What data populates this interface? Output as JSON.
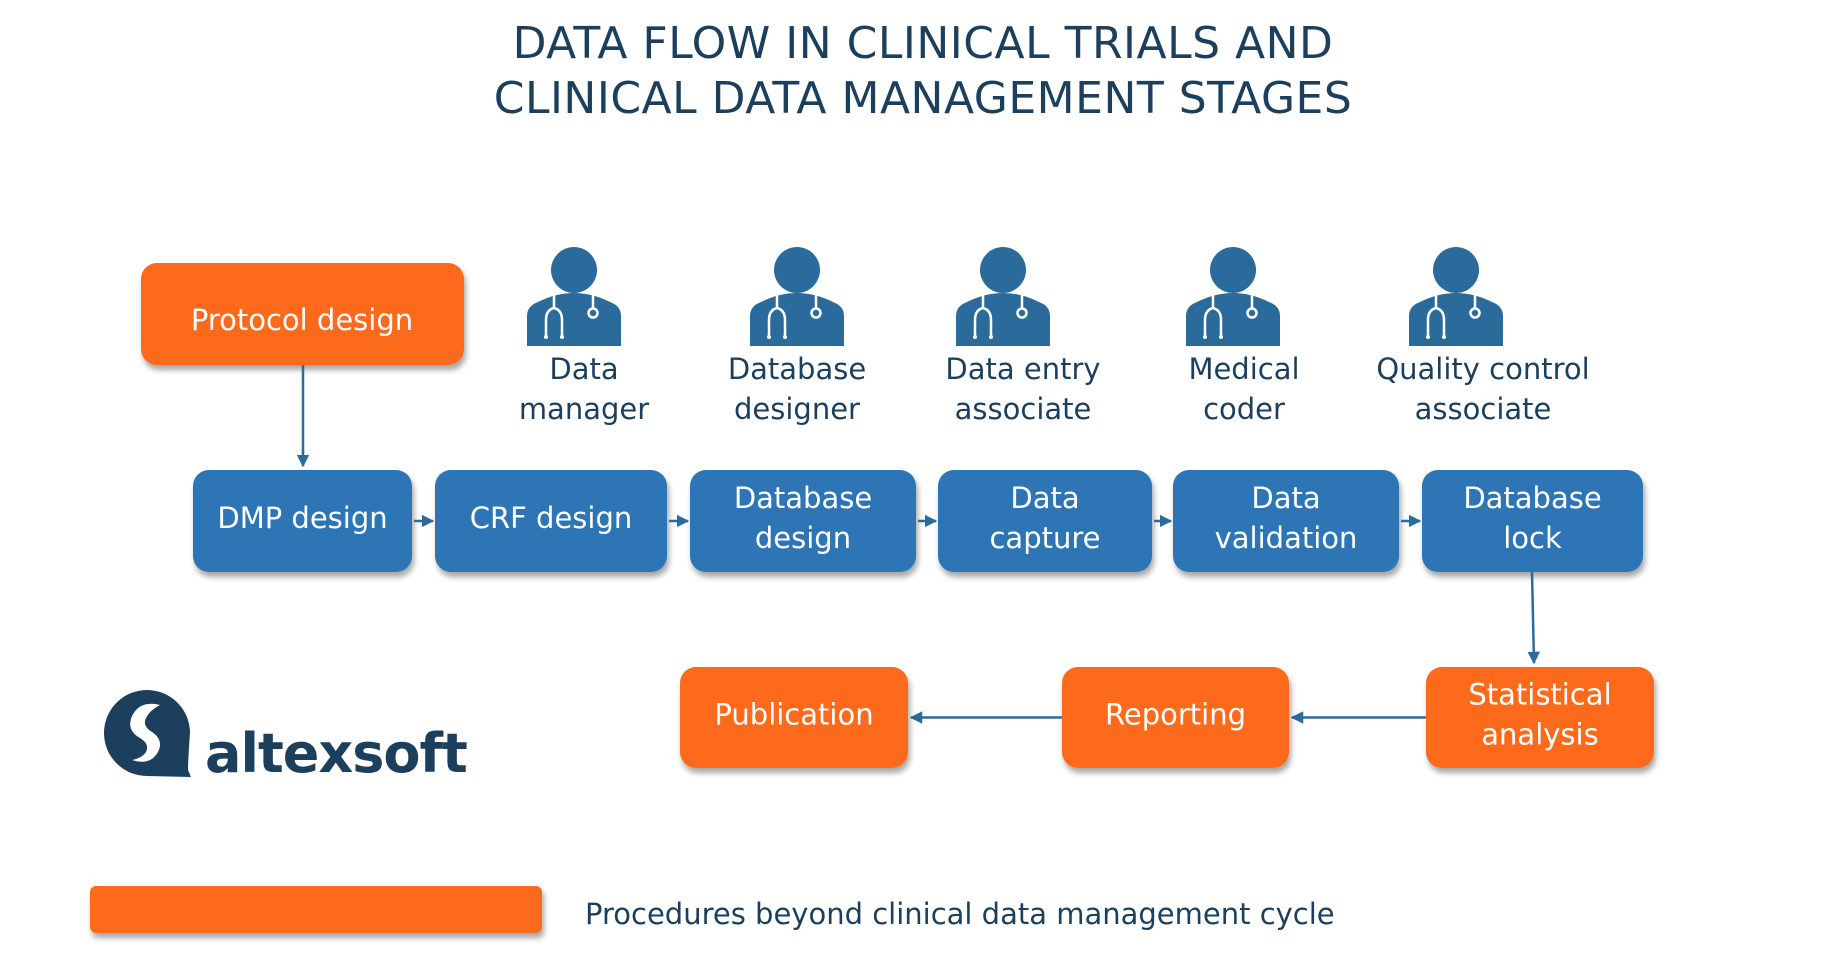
{
  "title": {
    "line1": "DATA FLOW IN CLINICAL TRIALS AND",
    "line2": "CLINICAL DATA MANAGEMENT STAGES"
  },
  "colors": {
    "orange": "#fd6b1c",
    "blue": "#2f74b5",
    "icon_blue": "#2a6b9c",
    "text_dark": "#1b3f5c"
  },
  "protocol": {
    "label": "Protocol design"
  },
  "roles": [
    {
      "icon": "doctor-stethoscope-icon",
      "lines": [
        "Data",
        "manager"
      ]
    },
    {
      "icon": "doctor-stethoscope-icon",
      "lines": [
        "Database",
        "designer"
      ]
    },
    {
      "icon": "doctor-stethoscope-icon",
      "lines": [
        "Data entry",
        "associate"
      ]
    },
    {
      "icon": "doctor-stethoscope-icon",
      "lines": [
        "Medical",
        "coder"
      ]
    },
    {
      "icon": "doctor-stethoscope-icon",
      "lines": [
        "Quality control",
        "associate"
      ]
    }
  ],
  "cdm_stages": [
    {
      "lines": [
        "DMP design"
      ]
    },
    {
      "lines": [
        "CRF design"
      ]
    },
    {
      "lines": [
        "Database",
        "design"
      ]
    },
    {
      "lines": [
        "Data",
        "capture"
      ]
    },
    {
      "lines": [
        "Data",
        "validation"
      ]
    },
    {
      "lines": [
        "Database",
        "lock"
      ]
    }
  ],
  "post_stages": [
    {
      "lines": [
        "Statistical",
        "analysis"
      ]
    },
    {
      "lines": [
        "Reporting"
      ]
    },
    {
      "lines": [
        "Publication"
      ]
    }
  ],
  "logo": {
    "text": "altexsoft"
  },
  "legend": {
    "label": "Procedures beyond clinical data management cycle"
  }
}
